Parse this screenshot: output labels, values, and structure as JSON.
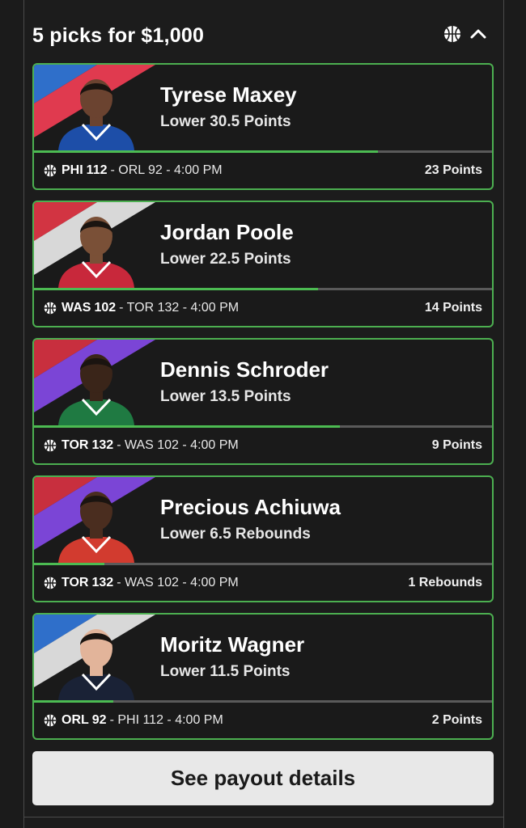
{
  "header": {
    "title": "5 picks for $1,000",
    "icon": "basketball-icon",
    "toggle_icon": "chevron-up-icon"
  },
  "colors": {
    "card_border": "#4caf50",
    "progress_fill": "#4cbb52",
    "progress_track": "#5a5a5a",
    "background": "#1b1b1b",
    "button_bg": "#e8e8e8"
  },
  "picks": [
    {
      "name": "Tyrese Maxey",
      "line": "Lower 30.5 Points",
      "team_abbr": "PHI",
      "team_score": "112",
      "opp_text": "- ORL 92 - 4:00 PM",
      "result": "23 Points",
      "progress": 0.75,
      "stripe_colors": [
        "#2f6fca",
        "#e03a4f"
      ],
      "jersey_color": "#1d4ea8",
      "skin": "#6b4330"
    },
    {
      "name": "Jordan Poole",
      "line": "Lower 22.5 Points",
      "team_abbr": "WAS",
      "team_score": "102",
      "opp_text": "- TOR 132 - 4:00 PM",
      "result": "14 Points",
      "progress": 0.62,
      "stripe_colors": [
        "#d23442",
        "#d8d8d8"
      ],
      "jersey_color": "#c8283b",
      "skin": "#7a5037"
    },
    {
      "name": "Dennis Schroder",
      "line": "Lower 13.5 Points",
      "team_abbr": "TOR",
      "team_score": "132",
      "opp_text": "- WAS 102 - 4:00 PM",
      "result": "9 Points",
      "progress": 0.667,
      "stripe_colors": [
        "#c82f3e",
        "#7b45d6"
      ],
      "jersey_color": "#1f7a42",
      "skin": "#3a2519"
    },
    {
      "name": "Precious Achiuwa",
      "line": "Lower 6.5 Rebounds",
      "team_abbr": "TOR",
      "team_score": "132",
      "opp_text": "- WAS 102 - 4:00 PM",
      "result": "1 Rebounds",
      "progress": 0.154,
      "stripe_colors": [
        "#c82f3e",
        "#7b45d6"
      ],
      "jersey_color": "#d23b2f",
      "skin": "#4a2d1f"
    },
    {
      "name": "Moritz Wagner",
      "line": "Lower 11.5 Points",
      "team_abbr": "ORL",
      "team_score": "92",
      "opp_text": "- PHI 112 - 4:00 PM",
      "result": "2 Points",
      "progress": 0.174,
      "stripe_colors": [
        "#2f6fca",
        "#d8d8d8"
      ],
      "jersey_color": "#1a2236",
      "skin": "#e2b49a"
    }
  ],
  "payout_button": {
    "label": "See payout details"
  }
}
